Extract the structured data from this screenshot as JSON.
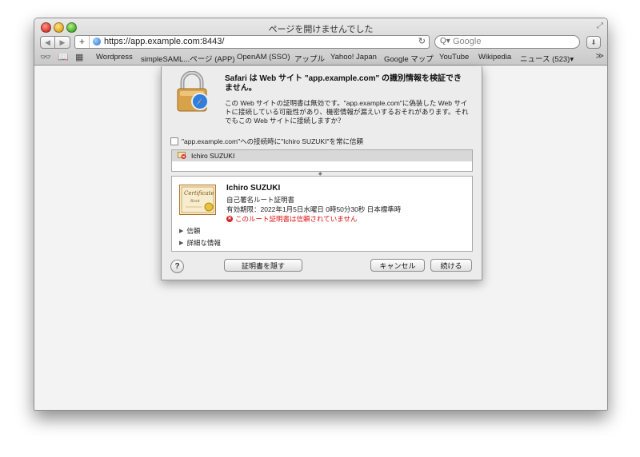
{
  "window": {
    "title": "ページを開けませんでした"
  },
  "toolbar": {
    "url": "https://app.example.com:8443/",
    "search_placeholder": "Google"
  },
  "bookmarks": {
    "items": [
      "Wordpress",
      "simpleSAML...ページ (APP)",
      "OpenAM (SSO)",
      "アップル",
      "Yahoo! Japan",
      "Google マップ",
      "YouTube",
      "Wikipedia",
      "ニュース (523)▾"
    ]
  },
  "dialog": {
    "title": "Safari は Web サイト \"app.example.com\" の識別情報を検証できません。",
    "body": "この Web サイトの証明書は無効です。\"app.example.com\"に偽装した Web サイトに接続している可能性があり、機密情報が漏えいするおそれがあります。それでもこの Web サイトに接続しますか？",
    "trust_checkbox_label": "\"app.example.com\"への接続時に\"Ichiro SUZUKI\"を常に信頼",
    "cert_list": [
      "Ichiro SUZUKI"
    ],
    "cert_detail": {
      "name": "Ichiro SUZUKI",
      "type": "自己署名ルート証明書",
      "expires": "有効期限：2022年1月5日水曜日 0時50分30秒 日本標準時",
      "warning": "このルート証明書は信頼されていません",
      "image_text": "Certificate",
      "image_subtext": "Root"
    },
    "sections": [
      "信頼",
      "詳細な情報"
    ],
    "buttons": {
      "help": "?",
      "hide_cert": "証明書を隠す",
      "cancel": "キャンセル",
      "continue": "続ける"
    }
  }
}
